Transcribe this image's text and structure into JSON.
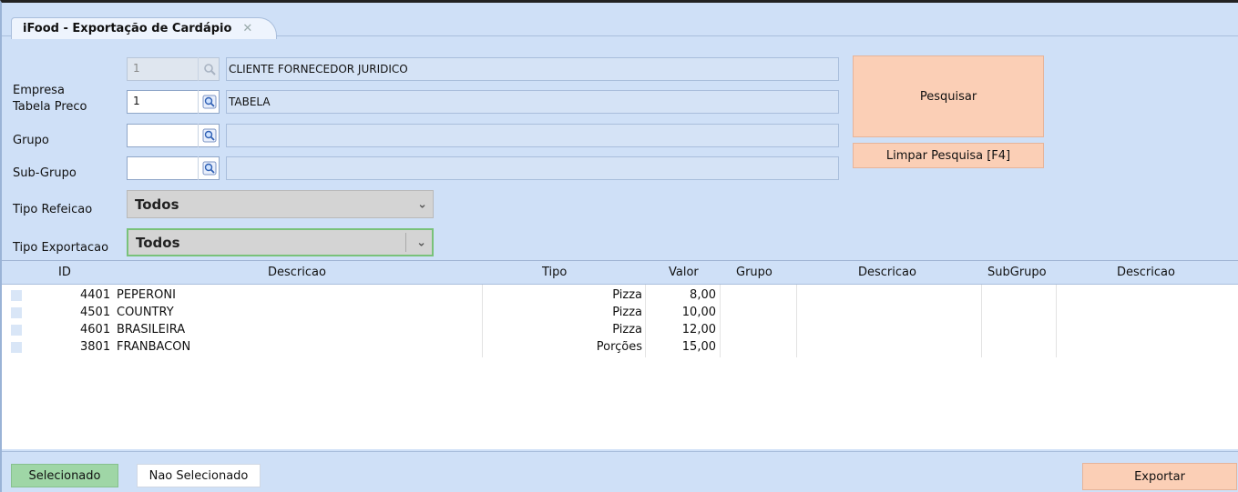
{
  "tab": {
    "title": "iFood - Exportação de Cardápio",
    "close": "✕"
  },
  "form": {
    "empresa": {
      "label": "Empresa",
      "code": "1",
      "desc": "CLIENTE FORNECEDOR JURIDICO"
    },
    "tabela_preco": {
      "label": "Tabela Preco",
      "code": "1",
      "desc": "TABELA"
    },
    "grupo": {
      "label": "Grupo",
      "code": "",
      "desc": ""
    },
    "sub_grupo": {
      "label": "Sub-Grupo",
      "code": "",
      "desc": ""
    },
    "tipo_refeicao": {
      "label": "Tipo Refeicao",
      "value": "Todos"
    },
    "tipo_exportacao": {
      "label": "Tipo Exportacao",
      "value": "Todos"
    }
  },
  "buttons": {
    "pesquisar": "Pesquisar",
    "limpar": "Limpar Pesquisa [F4]",
    "exportar": "Exportar"
  },
  "grid": {
    "columns": [
      "ID",
      "Descricao",
      "Tipo",
      "Valor",
      "Grupo",
      "Descricao",
      "SubGrupo",
      "Descricao"
    ],
    "rows": [
      {
        "id": "4401",
        "descricao": "PEPERONI",
        "tipo": "Pizza",
        "valor": "8,00"
      },
      {
        "id": "4501",
        "descricao": "COUNTRY",
        "tipo": "Pizza",
        "valor": "10,00"
      },
      {
        "id": "4601",
        "descricao": "BRASILEIRA",
        "tipo": "Pizza",
        "valor": "12,00"
      },
      {
        "id": "3801",
        "descricao": "FRANBACON",
        "tipo": "Porções",
        "valor": "15,00"
      }
    ]
  },
  "legend": {
    "selecionado": "Selecionado",
    "nao_selecionado": "Nao Selecionado"
  },
  "colors": {
    "background": "#cfe0f7",
    "salmon": "#fbcfb6",
    "selected_green": "#9fd6a6"
  }
}
